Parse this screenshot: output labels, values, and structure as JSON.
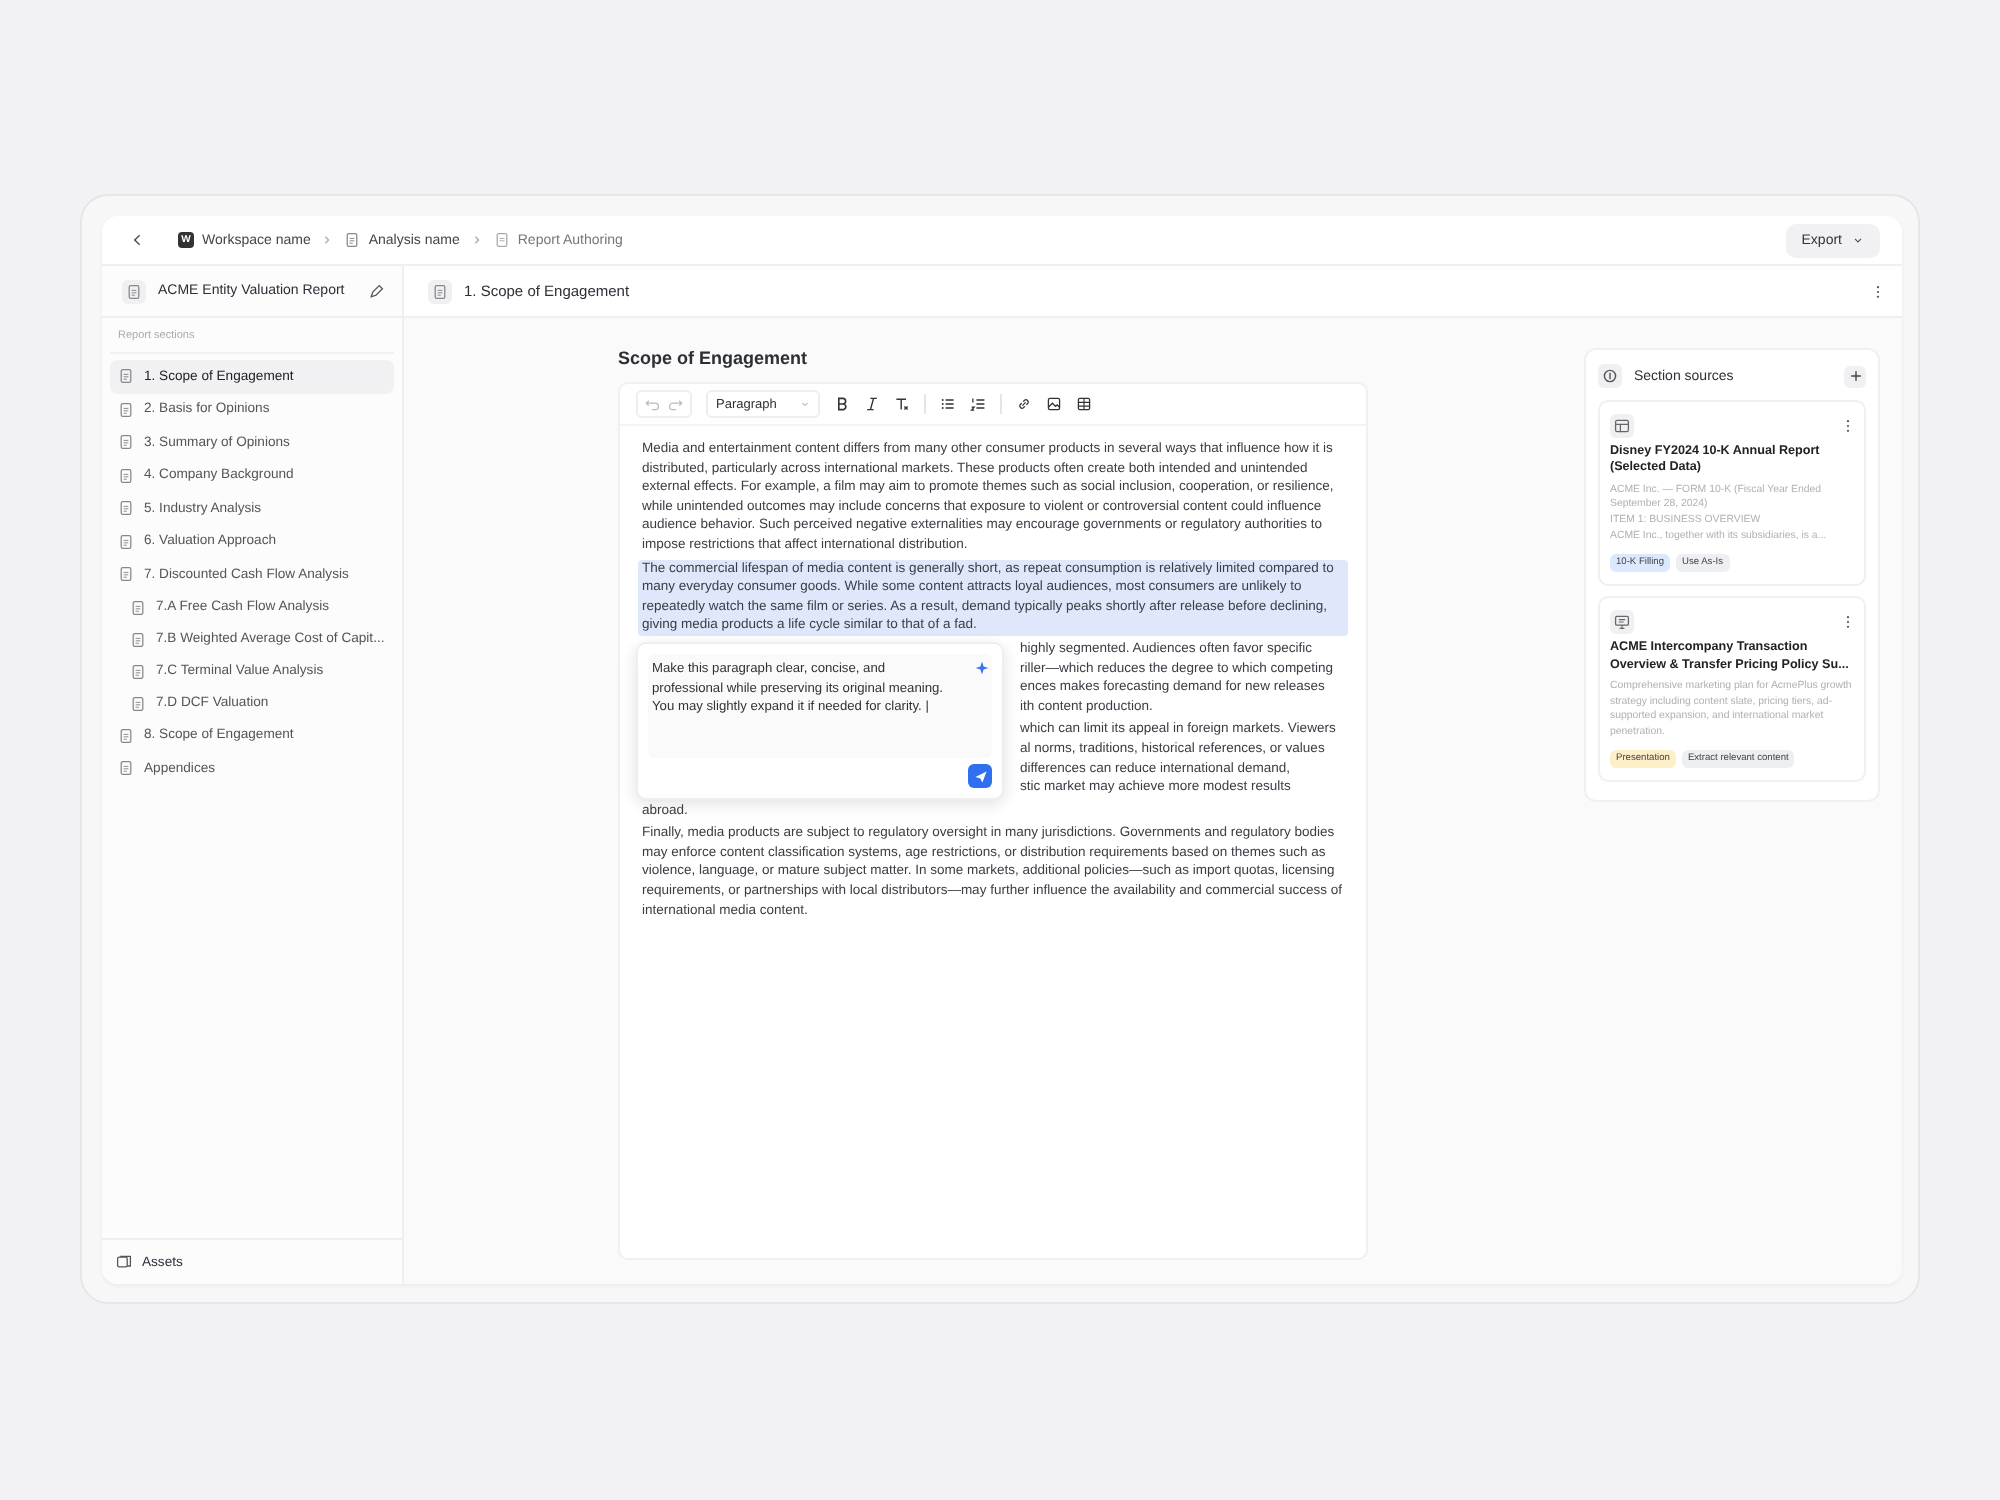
{
  "breadcrumb": [
    {
      "label": "Workspace name",
      "kind": "workspace",
      "badge": "W"
    },
    {
      "label": "Analysis name",
      "kind": "analysis"
    },
    {
      "label": "Report Authoring",
      "kind": "page"
    }
  ],
  "export_button": "Export",
  "sidebar": {
    "title": "ACME Entity Valuation Report",
    "section_label": "Report sections",
    "items": [
      {
        "label": "1. Scope of Engagement",
        "selected": true
      },
      {
        "label": "2. Basis for Opinions",
        "selected": false
      },
      {
        "label": "3. Summary of Opinions",
        "selected": false
      },
      {
        "label": "4. Company Background",
        "selected": false
      },
      {
        "label": "5. Industry Analysis",
        "selected": false
      },
      {
        "label": "6. Valuation Approach",
        "selected": false
      },
      {
        "label": "7. Discounted Cash Flow Analysis",
        "selected": false,
        "children": [
          {
            "label": "7.A  Free Cash Flow Analysis",
            "selected": false
          },
          {
            "label": "7.B  Weighted Average Cost of Capit...",
            "selected": false
          },
          {
            "label": "7.C  Terminal Value Analysis",
            "selected": false
          },
          {
            "label": "7.D  DCF Valuation",
            "selected": false
          }
        ]
      },
      {
        "label": "8. Scope of Engagement",
        "selected": false
      },
      {
        "label": "Appendices",
        "selected": false
      }
    ],
    "footer": "Assets"
  },
  "main_header": {
    "title": "1. Scope of Engagement"
  },
  "document": {
    "title": "Scope of Engagement",
    "block_style": "Paragraph",
    "paragraphs": [
      {
        "kind": "text",
        "selected": false,
        "text": "Media and entertainment content differs from many other consumer products in several ways that influence how it is distributed, particularly across international markets. These products often create both intended and unintended external effects. For example, a film may aim to promote themes such as social inclusion, cooperation, or resilience, while unintended outcomes may include concerns that exposure to violent or controversial content could influence audience behavior. Such perceived negative externalities may encourage governments or regulatory authorities to impose restrictions that affect international distribution."
      },
      {
        "kind": "text",
        "selected": true,
        "text": "The commercial lifespan of media content is generally short, as repeat consumption is relatively limited compared to many everyday consumer goods. While some content attracts loyal audiences, most consumers are unlikely to repeatedly watch the same film or series. As a result, demand typically peaks shortly after release before declining, giving media products a life cycle similar to that of a fad."
      },
      {
        "kind": "covered",
        "lines": [
          "highly segmented. Audiences often favor specific",
          "riller—which reduces the degree to which competing",
          "ences makes forecasting demand for new releases",
          "ith content production."
        ]
      },
      {
        "kind": "covered",
        "lines": [
          "which can limit its appeal in foreign markets. Viewers",
          "al norms, traditions, historical references, or values",
          "differences can reduce international demand,",
          "stic market may achieve more modest results"
        ],
        "tail": "abroad."
      },
      {
        "kind": "text",
        "selected": false,
        "text": "Finally, media products are subject to regulatory oversight in many jurisdictions. Governments and regulatory bodies may enforce content classification systems, age restrictions, or distribution requirements based on themes such as violence, language, or mature subject matter. In some markets, additional policies—such as import quotas, licensing requirements, or partnerships with local distributors—may further influence the availability and commercial success of international media content."
      }
    ],
    "ai_prompt": "Make this paragraph clear, concise, and professional while preserving its original meaning. You may slightly expand it if needed for clarity. |"
  },
  "sources": {
    "title": "Section sources",
    "items": [
      {
        "kind": "table",
        "title": "Disney FY2024 10-K Annual Report (Selected Data)",
        "lines": [
          "ACME Inc. — FORM 10-K (Fiscal Year Ended September 28, 2024)",
          "ITEM 1: BUSINESS OVERVIEW",
          "ACME Inc., together with its subsidiaries, is a..."
        ],
        "tags": [
          {
            "label": "10-K Filling",
            "color": "#dbe8fd"
          },
          {
            "label": "Use As-Is",
            "color": "#eeeff2"
          }
        ]
      },
      {
        "kind": "presentation",
        "title": "ACME Intercompany Transaction Overview & Transfer Pricing Policy Su...",
        "lines": [
          "Comprehensive marketing plan for AcmePlus growth strategy including content slate, pricing tiers, ad-supported expansion, and international market penetration."
        ],
        "tags": [
          {
            "label": "Presentation",
            "color": "#fdf0c8"
          },
          {
            "label": "Extract relevant content",
            "color": "#eeeff2"
          }
        ]
      }
    ]
  }
}
